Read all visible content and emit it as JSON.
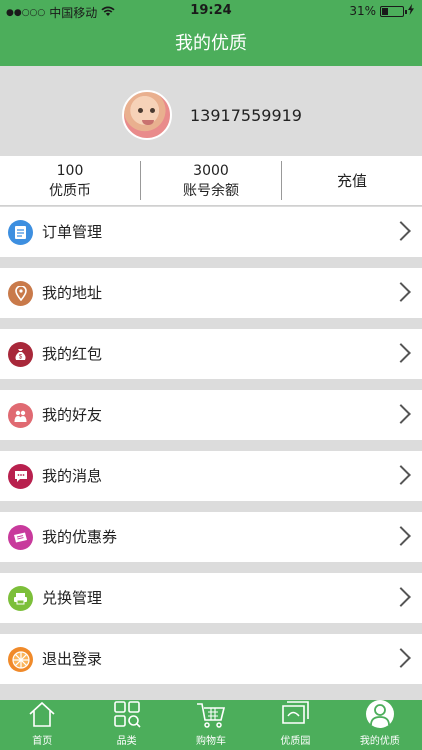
{
  "status_bar": {
    "carrier": "中国移动",
    "time": "19:24",
    "battery": "31%",
    "battery_level": 0.31
  },
  "header": {
    "title": "我的优质"
  },
  "profile": {
    "phone": "13917559919"
  },
  "stats": [
    {
      "value": "100",
      "label": "优质币"
    },
    {
      "value": "3000",
      "label": "账号余额"
    },
    {
      "label": "充值"
    }
  ],
  "menu": [
    {
      "label": "订单管理",
      "icon": "document-icon",
      "color": "#3d8fe0"
    },
    {
      "label": "我的地址",
      "icon": "location-pin-icon",
      "color": "#c97a4a"
    },
    {
      "label": "我的红包",
      "icon": "money-bag-icon",
      "color": "#a8283a"
    },
    {
      "label": "我的好友",
      "icon": "friends-icon",
      "color": "#e06a72"
    },
    {
      "label": "我的消息",
      "icon": "message-icon",
      "color": "#b8204e"
    },
    {
      "label": "我的优惠券",
      "icon": "coupon-icon",
      "color": "#c83a9c"
    },
    {
      "label": "兑换管理",
      "icon": "exchange-icon",
      "color": "#7cbf3a"
    },
    {
      "label": "退出登录",
      "icon": "orange-slice-icon",
      "color": "#f08a2a"
    }
  ],
  "tabs": [
    {
      "label": "首页",
      "icon": "home-icon"
    },
    {
      "label": "品类",
      "icon": "category-icon"
    },
    {
      "label": "购物车",
      "icon": "cart-icon"
    },
    {
      "label": "优质园",
      "icon": "garden-icon"
    },
    {
      "label": "我的优质",
      "icon": "user-icon",
      "active": true
    }
  ],
  "colors": {
    "brand": "#4cae5b",
    "background": "#dcdcdc"
  }
}
